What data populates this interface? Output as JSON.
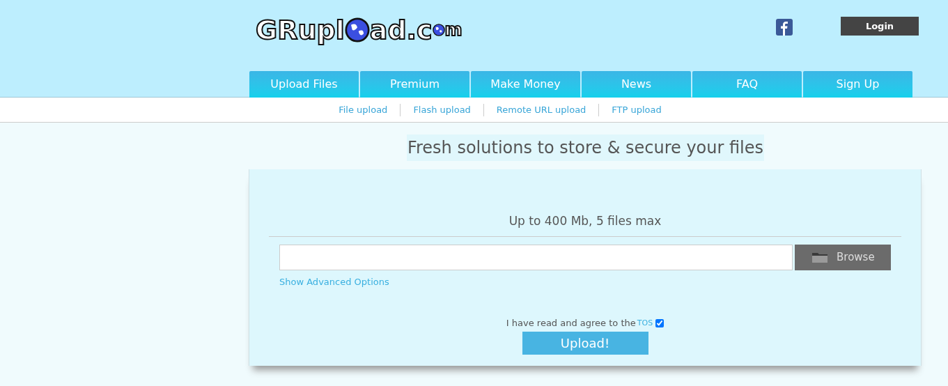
{
  "logo": {
    "parts": [
      "GRupl",
      "ad.c",
      "m"
    ]
  },
  "login_button": "Login",
  "nav": [
    {
      "label": "Upload Files",
      "selected": false
    },
    {
      "label": "Premium",
      "selected": false
    },
    {
      "label": "Make Money",
      "selected": false
    },
    {
      "label": "News",
      "selected": false
    },
    {
      "label": "FAQ",
      "selected": false
    },
    {
      "label": "Sign Up",
      "selected": false
    }
  ],
  "upload_modes": [
    "File upload",
    "Flash upload",
    "Remote URL upload",
    "FTP upload"
  ],
  "headline": "Fresh solutions to store & secure your files",
  "upload_box": {
    "limit": "Up to 400 Mb, 5 files max",
    "browse_button": "Browse",
    "advanced_link": "Show Advanced Options",
    "tos_text": "I have read and agree to the",
    "tos_link": "TOS",
    "tos_checked": true,
    "upload_button": "Upload!"
  }
}
